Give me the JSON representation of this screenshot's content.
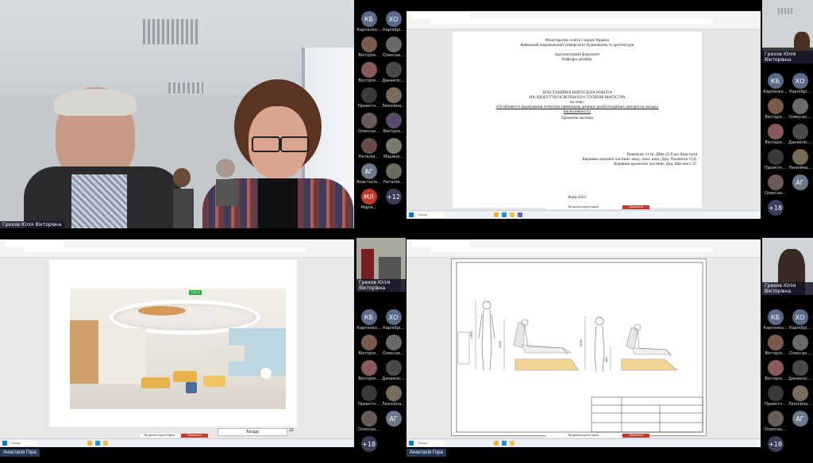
{
  "speaker_name": "Грехов Юлія Вікторівна",
  "presenter_name": "Анастасія Гора",
  "strip1": [
    {
      "initials": "КБ",
      "name": "Карпенко...",
      "color": "#5a6b8a"
    },
    {
      "initials": "ХО",
      "name": "Карпібрі...",
      "color": "#5a6b8a"
    },
    {
      "initials": "",
      "name": "Вікторія...",
      "color": "#7a5a4a"
    },
    {
      "initials": "",
      "name": "Олексан...",
      "color": "#6a6a6a"
    },
    {
      "initials": "",
      "name": "Вікторія...",
      "color": "#8a5a5a"
    },
    {
      "initials": "",
      "name": "Даниеліс...",
      "color": "#4a4a4a"
    },
    {
      "initials": "",
      "name": "Проектн...",
      "color": "#3a3a3a"
    },
    {
      "initials": "",
      "name": "Леонійна...",
      "color": "#7a6a5a"
    },
    {
      "initials": "",
      "name": "Олексан...",
      "color": "#6a5a5a"
    },
    {
      "initials": "",
      "name": "Вікторія...",
      "color": "#5a4a6a"
    },
    {
      "initials": "",
      "name": "Наталія...",
      "color": "#6a4a4a"
    },
    {
      "initials": "",
      "name": "Марина...",
      "color": "#7a7a6a"
    },
    {
      "initials": "АГ",
      "name": "Анастасія...",
      "color": "#6a7a8a"
    },
    {
      "initials": "",
      "name": "Наталія...",
      "color": "#6a6a5a"
    },
    {
      "initials": "МЛ",
      "name": "Марія...",
      "color": "#c0392b"
    },
    {
      "initials": "+12",
      "name": "",
      "color": "#3b3d5a"
    }
  ],
  "strip2": [
    {
      "initials": "КБ",
      "name": "Карпенко...",
      "color": "#5a6b8a"
    },
    {
      "initials": "ХО",
      "name": "Карпібрі...",
      "color": "#5a6b8a"
    },
    {
      "initials": "",
      "name": "Вікторія...",
      "color": "#7a5a4a"
    },
    {
      "initials": "",
      "name": "Олексан...",
      "color": "#6a6a6a"
    },
    {
      "initials": "",
      "name": "Вікторія...",
      "color": "#8a5a5a"
    },
    {
      "initials": "",
      "name": "Даниеліс...",
      "color": "#4a4a4a"
    },
    {
      "initials": "",
      "name": "Проектн...",
      "color": "#3a3a3a"
    },
    {
      "initials": "",
      "name": "Леонійна...",
      "color": "#7a6a5a"
    },
    {
      "initials": "",
      "name": "Олексан...",
      "color": "#6a5a5a"
    },
    {
      "initials": "АГ",
      "name": "",
      "color": "#6a7a8a"
    },
    {
      "initials": "+18",
      "name": "",
      "color": "#3b3d5a"
    }
  ],
  "strip3": [
    {
      "initials": "КБ",
      "name": "Карпенко...",
      "color": "#5a6b8a"
    },
    {
      "initials": "ХО",
      "name": "Карпібрі...",
      "color": "#5a6b8a"
    },
    {
      "initials": "",
      "name": "Вікторія...",
      "color": "#7a5a4a"
    },
    {
      "initials": "",
      "name": "Олексан...",
      "color": "#6a6a6a"
    },
    {
      "initials": "",
      "name": "Вікторія...",
      "color": "#8a5a5a"
    },
    {
      "initials": "",
      "name": "Даниеліс...",
      "color": "#4a4a4a"
    },
    {
      "initials": "",
      "name": "Проектн...",
      "color": "#3a3a3a"
    },
    {
      "initials": "",
      "name": "Леонійна...",
      "color": "#7a6a5a"
    },
    {
      "initials": "",
      "name": "Олексан...",
      "color": "#6a5a5a"
    },
    {
      "initials": "АГ",
      "name": "",
      "color": "#6a7a8a"
    },
    {
      "initials": "+18",
      "name": "",
      "color": "#3b3d5a"
    }
  ],
  "title_doc": {
    "line1": "Міністерство освіти і науки України",
    "line2": "Київський національний університет будівництва та архітектури",
    "line3": "Архітектурний факультет",
    "line4": "Кафедра дизайну",
    "line5": "АТЕСТАЦІЙНА ВИПУСКНА РОБОТА",
    "line6": "НА ЗДОБУТТЯ ОСВІТНЬОГО СТУПЕНЯ МАГІСТРА",
    "line7": "на тему:",
    "line8": "«Особливості формування інтер'єрів приміщень дитячих реабілітаційних центрів на засадах",
    "line9": "інклюзивності»",
    "line10": "Проектна частина",
    "line11": "Виконала: ст.гр. ДНм-22 Гора Анастасія",
    "line12": "Керівник наукової частини: канд. техн. наук, Доц. Пасмичук О.Д.",
    "line13": "Керівник проектної частини: Доц. Щеглов С.П.",
    "line14": "Київ-2023"
  },
  "slide_page": "23",
  "slide_name": "Бесіда",
  "render_sign": "ТЕХ 3",
  "taskbar_search": "Пошук",
  "presenting_label": "Припинити демонстрацію",
  "sharing_text": "Ви демонструєте екран",
  "drawing_dims": [
    "1300",
    "1020",
    "380",
    "1035"
  ]
}
